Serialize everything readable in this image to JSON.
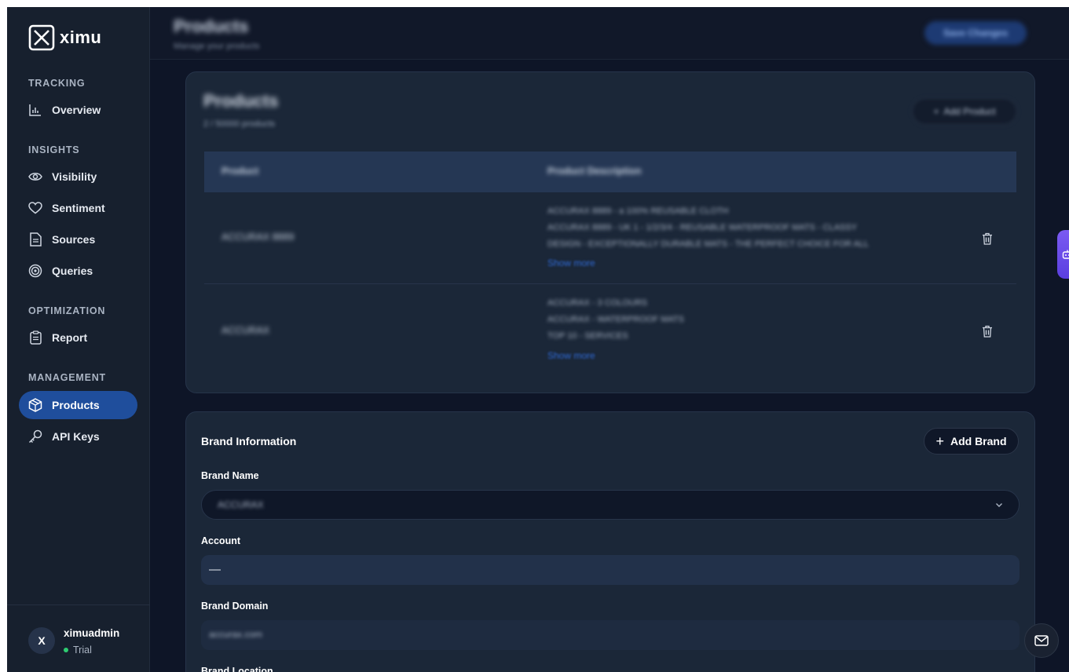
{
  "app": {
    "logo_text": "ximu"
  },
  "sidebar": {
    "sections": [
      {
        "label": "TRACKING",
        "items": [
          {
            "label": "Overview",
            "icon": "bar-chart-icon"
          }
        ]
      },
      {
        "label": "INSIGHTS",
        "items": [
          {
            "label": "Visibility",
            "icon": "eye-icon"
          },
          {
            "label": "Sentiment",
            "icon": "heart-icon"
          },
          {
            "label": "Sources",
            "icon": "document-icon"
          },
          {
            "label": "Queries",
            "icon": "target-icon"
          }
        ]
      },
      {
        "label": "OPTIMIZATION",
        "items": [
          {
            "label": "Report",
            "icon": "clipboard-icon"
          }
        ]
      },
      {
        "label": "MANAGEMENT",
        "items": [
          {
            "label": "Products",
            "icon": "package-icon",
            "active": true
          },
          {
            "label": "API Keys",
            "icon": "key-icon"
          }
        ]
      }
    ]
  },
  "user": {
    "initial": "X",
    "name": "ximuadmin",
    "plan": "Trial",
    "status_color": "#2ecc71"
  },
  "header": {
    "title": "Products",
    "subtitle": "Manage your products",
    "save_label": "Save Changes"
  },
  "products_card": {
    "title": "Products",
    "subtitle": "2 / 50000 products",
    "add_label": "Add Product",
    "columns": [
      "Product",
      "Product Description"
    ],
    "rows": [
      {
        "name": "ACCURAX 8889",
        "description": [
          "ACCURAX 8889 - a 100% REUSABLE CLOTH",
          "ACCURAX 8889 - UK 1 - 1/2/3/4 - REUSABLE WATERPROOF MATS - CLASSY",
          "DESIGN - EXCEPTIONALLY DURABLE MATS - THE PERFECT CHOICE FOR ALL"
        ],
        "show_more": "Show more"
      },
      {
        "name": "ACCURAX",
        "description": [
          "ACCURAX - 3 COLOURS",
          "ACCURAX - WATERPROOF MATS",
          "TOP 10 - SERVICES"
        ],
        "show_more": "Show more"
      }
    ]
  },
  "brand_card": {
    "title": "Brand Information",
    "add_label": "Add Brand",
    "fields": {
      "brand_name_label": "Brand Name",
      "brand_name_value": "ACCURAX",
      "account_label": "Account",
      "account_value": "—",
      "brand_domain_label": "Brand Domain",
      "brand_domain_value": "accurax.com",
      "brand_location_label": "Brand Location"
    }
  },
  "colors": {
    "accent": "#1f4e9c",
    "link": "#2f6ad6",
    "background": "#0e1527"
  }
}
